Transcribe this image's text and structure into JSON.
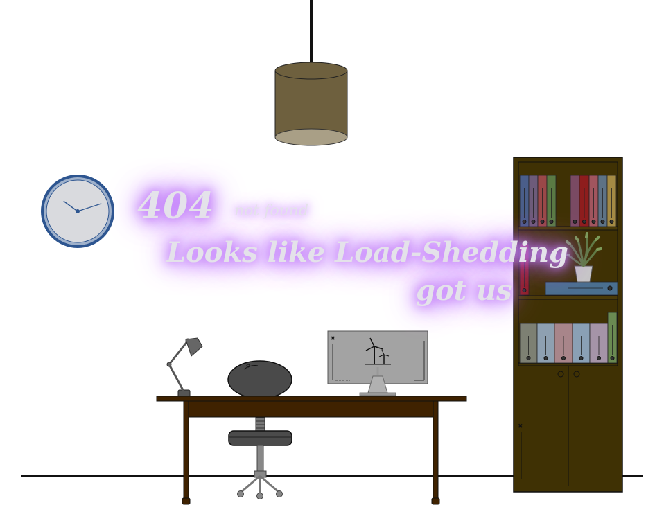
{
  "message": {
    "code": "404",
    "subtitle": "not found",
    "line1": "Looks like Load-Shedding",
    "line2": "got us"
  },
  "clock": {
    "hour": 10,
    "minute": 12
  },
  "colors": {
    "wall": "#ffffff",
    "floor_line": "#111111",
    "neon_glow": "#b25cf4",
    "neon_text": "#e4e2ea",
    "lamp_shade": "#6e603e",
    "lamp_shade_bottom": "#a99f86",
    "clock_rim": "#2d5590",
    "clock_face": "#d9dade",
    "desk": "#3f2200",
    "cabinet": "#3f3104",
    "monitor": "#a3a3a3",
    "chair": "#4b4b4b"
  },
  "icons": [
    "pendant-lamp-icon",
    "wall-clock-icon",
    "desk-lamp-icon",
    "rock-icon",
    "monitor-icon",
    "wind-turbine-icon",
    "chair-icon",
    "bookcase-icon",
    "plant-icon"
  ]
}
